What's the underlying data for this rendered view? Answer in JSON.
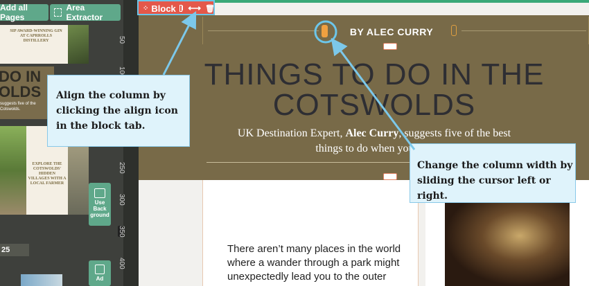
{
  "toolbar": {
    "add_pages_label": "Add all Pages",
    "area_extractor_label": "Area Extractor"
  },
  "thumbnails": {
    "page1_heading": "SIP AWARD-WINNING GIN AT CAPRROLLS DISTILLERY",
    "page2_title": "DO IN OLDS",
    "page2_sub": "suggests five of the Cotswolds.",
    "page3_heading": "EXPLORE THE COTSWOLDS' HIDDEN VILLAGES WITH A LOCAL FARMER"
  },
  "side_buttons": {
    "background_label": "Use Back ground",
    "add_label": "Ad"
  },
  "page_number": "25",
  "ruler": {
    "labels": [
      "50",
      "100",
      "150",
      "200",
      "250",
      "300",
      "350",
      "400"
    ]
  },
  "block_tab": {
    "label": "Block",
    "icons": [
      "drag-icon",
      "columns-icon",
      "resize-arrows-icon",
      "trash-icon"
    ]
  },
  "hero": {
    "byline": "BY ALEC CURRY",
    "title_line1": "THINGS TO DO IN THE",
    "title_line2": "COTSWOLDS",
    "subtitle_prefix": "UK Destination Expert, ",
    "subtitle_bold": "Alec Curry",
    "subtitle_suffix": ", suggests five of the best",
    "subtitle_line2": "things to do when you visi"
  },
  "body": {
    "paragraph": "There aren’t many places in the world where a wander through a park might unexpectedly lead you to the outer"
  },
  "callouts": {
    "align": "Align the column by clicking the align icon in the block tab.",
    "width": "Change the column width by sliding the cursor left or right."
  },
  "colors": {
    "accent_green": "#5fa88a",
    "hero_bg": "#786a48",
    "block_tab_red": "#e4584a",
    "callout_bg": "#dff3fb",
    "callout_border": "#88c8e8",
    "handle_orange": "#f0a040"
  }
}
